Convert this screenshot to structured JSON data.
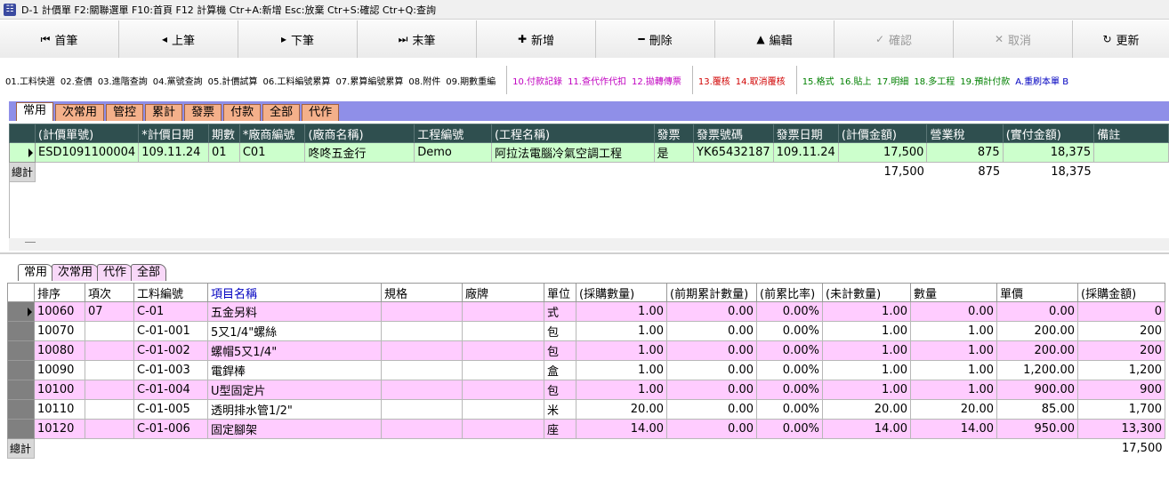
{
  "window": {
    "title": "D-1 計價單   F2:關聯選單  F10:首頁  F12 計算機  Ctr+A:新增  Esc:放棄  Ctr+S:確認  Ctr+Q:查詢"
  },
  "toolbar": {
    "first": "首筆",
    "prev": "上筆",
    "next": "下筆",
    "last": "末筆",
    "add": "新增",
    "delete": "刪除",
    "edit": "編輯",
    "confirm": "確認",
    "cancel": "取消",
    "refresh": "更新"
  },
  "funcbar": {
    "g1": [
      "01.工料快選",
      "02.查價",
      "03.進階查詢",
      "04.黨號查詢",
      "05.計價試算",
      "06.工料編號累算",
      "07.累算編號累算",
      "08.附件",
      "09.期數重編"
    ],
    "g2": [
      "10.付款記錄",
      "11.查代作代扣",
      "12.拋轉傳票"
    ],
    "g3": [
      "13.覆核",
      "14.取消覆核"
    ],
    "g4": [
      "15.格式",
      "16.貼上",
      "17.明細",
      "18.多工程",
      "19.預計付款"
    ],
    "g4_blue": "A.重刷本單  B"
  },
  "top_tabs": [
    "常用",
    "次常用",
    "管控",
    "累計",
    "發票",
    "付款",
    "全部",
    "代作"
  ],
  "upper_grid": {
    "headers": [
      "(計價單號)",
      "*計價日期",
      "期數",
      "*廠商編號",
      "(廠商名稱)",
      "工程編號",
      "(工程名稱)",
      "發票",
      "發票號碼",
      "發票日期",
      "(計價金額)",
      "營業稅",
      "(實付金額)",
      "備註"
    ],
    "rows": [
      [
        "ESD1091100004",
        "109.11.24",
        "01",
        "C01",
        "咚咚五金行",
        "Demo",
        "阿拉法電腦冷氣空調工程",
        "是",
        "YK65432187",
        "109.11.24",
        "17,500",
        "875",
        "18,375",
        ""
      ]
    ],
    "total_label": "總計",
    "totals": {
      "amount": "17,500",
      "tax": "875",
      "paid": "18,375"
    }
  },
  "bottom_tabs": [
    "常用",
    "次常用",
    "代作",
    "全部"
  ],
  "lower_grid": {
    "headers": [
      "排序",
      "項次",
      "工料編號",
      "項目名稱",
      "規格",
      "廠牌",
      "單位",
      "(採購數量)",
      "(前期累計數量)",
      "(前累比率)",
      "(未計數量)",
      "數量",
      "單價",
      "(採購金額)"
    ],
    "rows": [
      [
        "10060",
        "07",
        "C-01",
        "五金另料",
        "",
        "",
        "式",
        "1.00",
        "0.00",
        "0.00%",
        "1.00",
        "0.00",
        "0.00",
        "0"
      ],
      [
        "10070",
        "",
        "C-01-001",
        "5又1/4\"螺絲",
        "",
        "",
        "包",
        "1.00",
        "0.00",
        "0.00%",
        "1.00",
        "1.00",
        "200.00",
        "200"
      ],
      [
        "10080",
        "",
        "C-01-002",
        "螺帽5又1/4\"",
        "",
        "",
        "包",
        "1.00",
        "0.00",
        "0.00%",
        "1.00",
        "1.00",
        "200.00",
        "200"
      ],
      [
        "10090",
        "",
        "C-01-003",
        "電銲棒",
        "",
        "",
        "盒",
        "1.00",
        "0.00",
        "0.00%",
        "1.00",
        "1.00",
        "1,200.00",
        "1,200"
      ],
      [
        "10100",
        "",
        "C-01-004",
        "U型固定片",
        "",
        "",
        "包",
        "1.00",
        "0.00",
        "0.00%",
        "1.00",
        "1.00",
        "900.00",
        "900"
      ],
      [
        "10110",
        "",
        "C-01-005",
        "透明排水管1/2\"",
        "",
        "",
        "米",
        "20.00",
        "0.00",
        "0.00%",
        "20.00",
        "20.00",
        "85.00",
        "1,700"
      ],
      [
        "10120",
        "",
        "C-01-006",
        "固定腳架",
        "",
        "",
        "座",
        "14.00",
        "0.00",
        "0.00%",
        "14.00",
        "14.00",
        "950.00",
        "13,300"
      ]
    ],
    "total_label": "總計",
    "total_amount": "17,500"
  },
  "colors": {
    "header_dark": "#2f4f4f",
    "row_green": "#ccffcc",
    "row_pink": "#ffccff",
    "tab_orange": "#f4b08a",
    "tabstrip_blue": "#8f8fe8"
  }
}
